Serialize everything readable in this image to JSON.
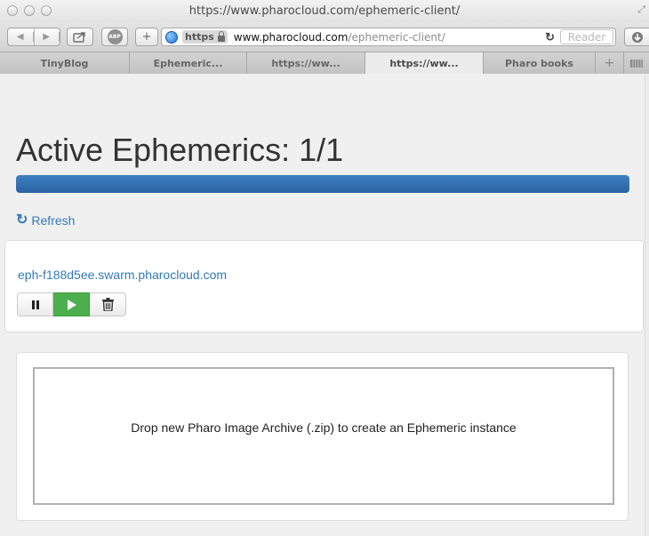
{
  "window": {
    "title": "https://www.pharocloud.com/ephemeric-client/"
  },
  "toolbar": {
    "abp_label": "ABP",
    "plus_label": "+",
    "https_label": "https",
    "url_host": "www.pharocloud.com",
    "url_path": "/ephemeric-client/",
    "reload_icon": "reload-icon",
    "reader_label": "Reader"
  },
  "tabs": [
    {
      "label": "TinyBlog",
      "active": false
    },
    {
      "label": "Ephemeric...",
      "active": false
    },
    {
      "label": "https://ww...",
      "active": false
    },
    {
      "label": "https://ww...",
      "active": true
    },
    {
      "label": "Pharo books",
      "active": false
    }
  ],
  "new_tab_label": "+",
  "page": {
    "heading": "Active Ephemerics: 1/1",
    "progress_fraction": 1.0,
    "progress_color": "#2f6ead",
    "refresh_label": "Refresh",
    "instance": {
      "hostname": "eph-f188d5ee.swarm.pharocloud.com",
      "buttons": [
        {
          "name": "pause-button",
          "icon": "pause-icon"
        },
        {
          "name": "play-button",
          "icon": "play-icon",
          "color": "#4cae4c"
        },
        {
          "name": "delete-button",
          "icon": "trash-icon"
        }
      ]
    },
    "drop_zone_text": "Drop new Pharo Image Archive (.zip) to create an Ephemeric instance"
  }
}
